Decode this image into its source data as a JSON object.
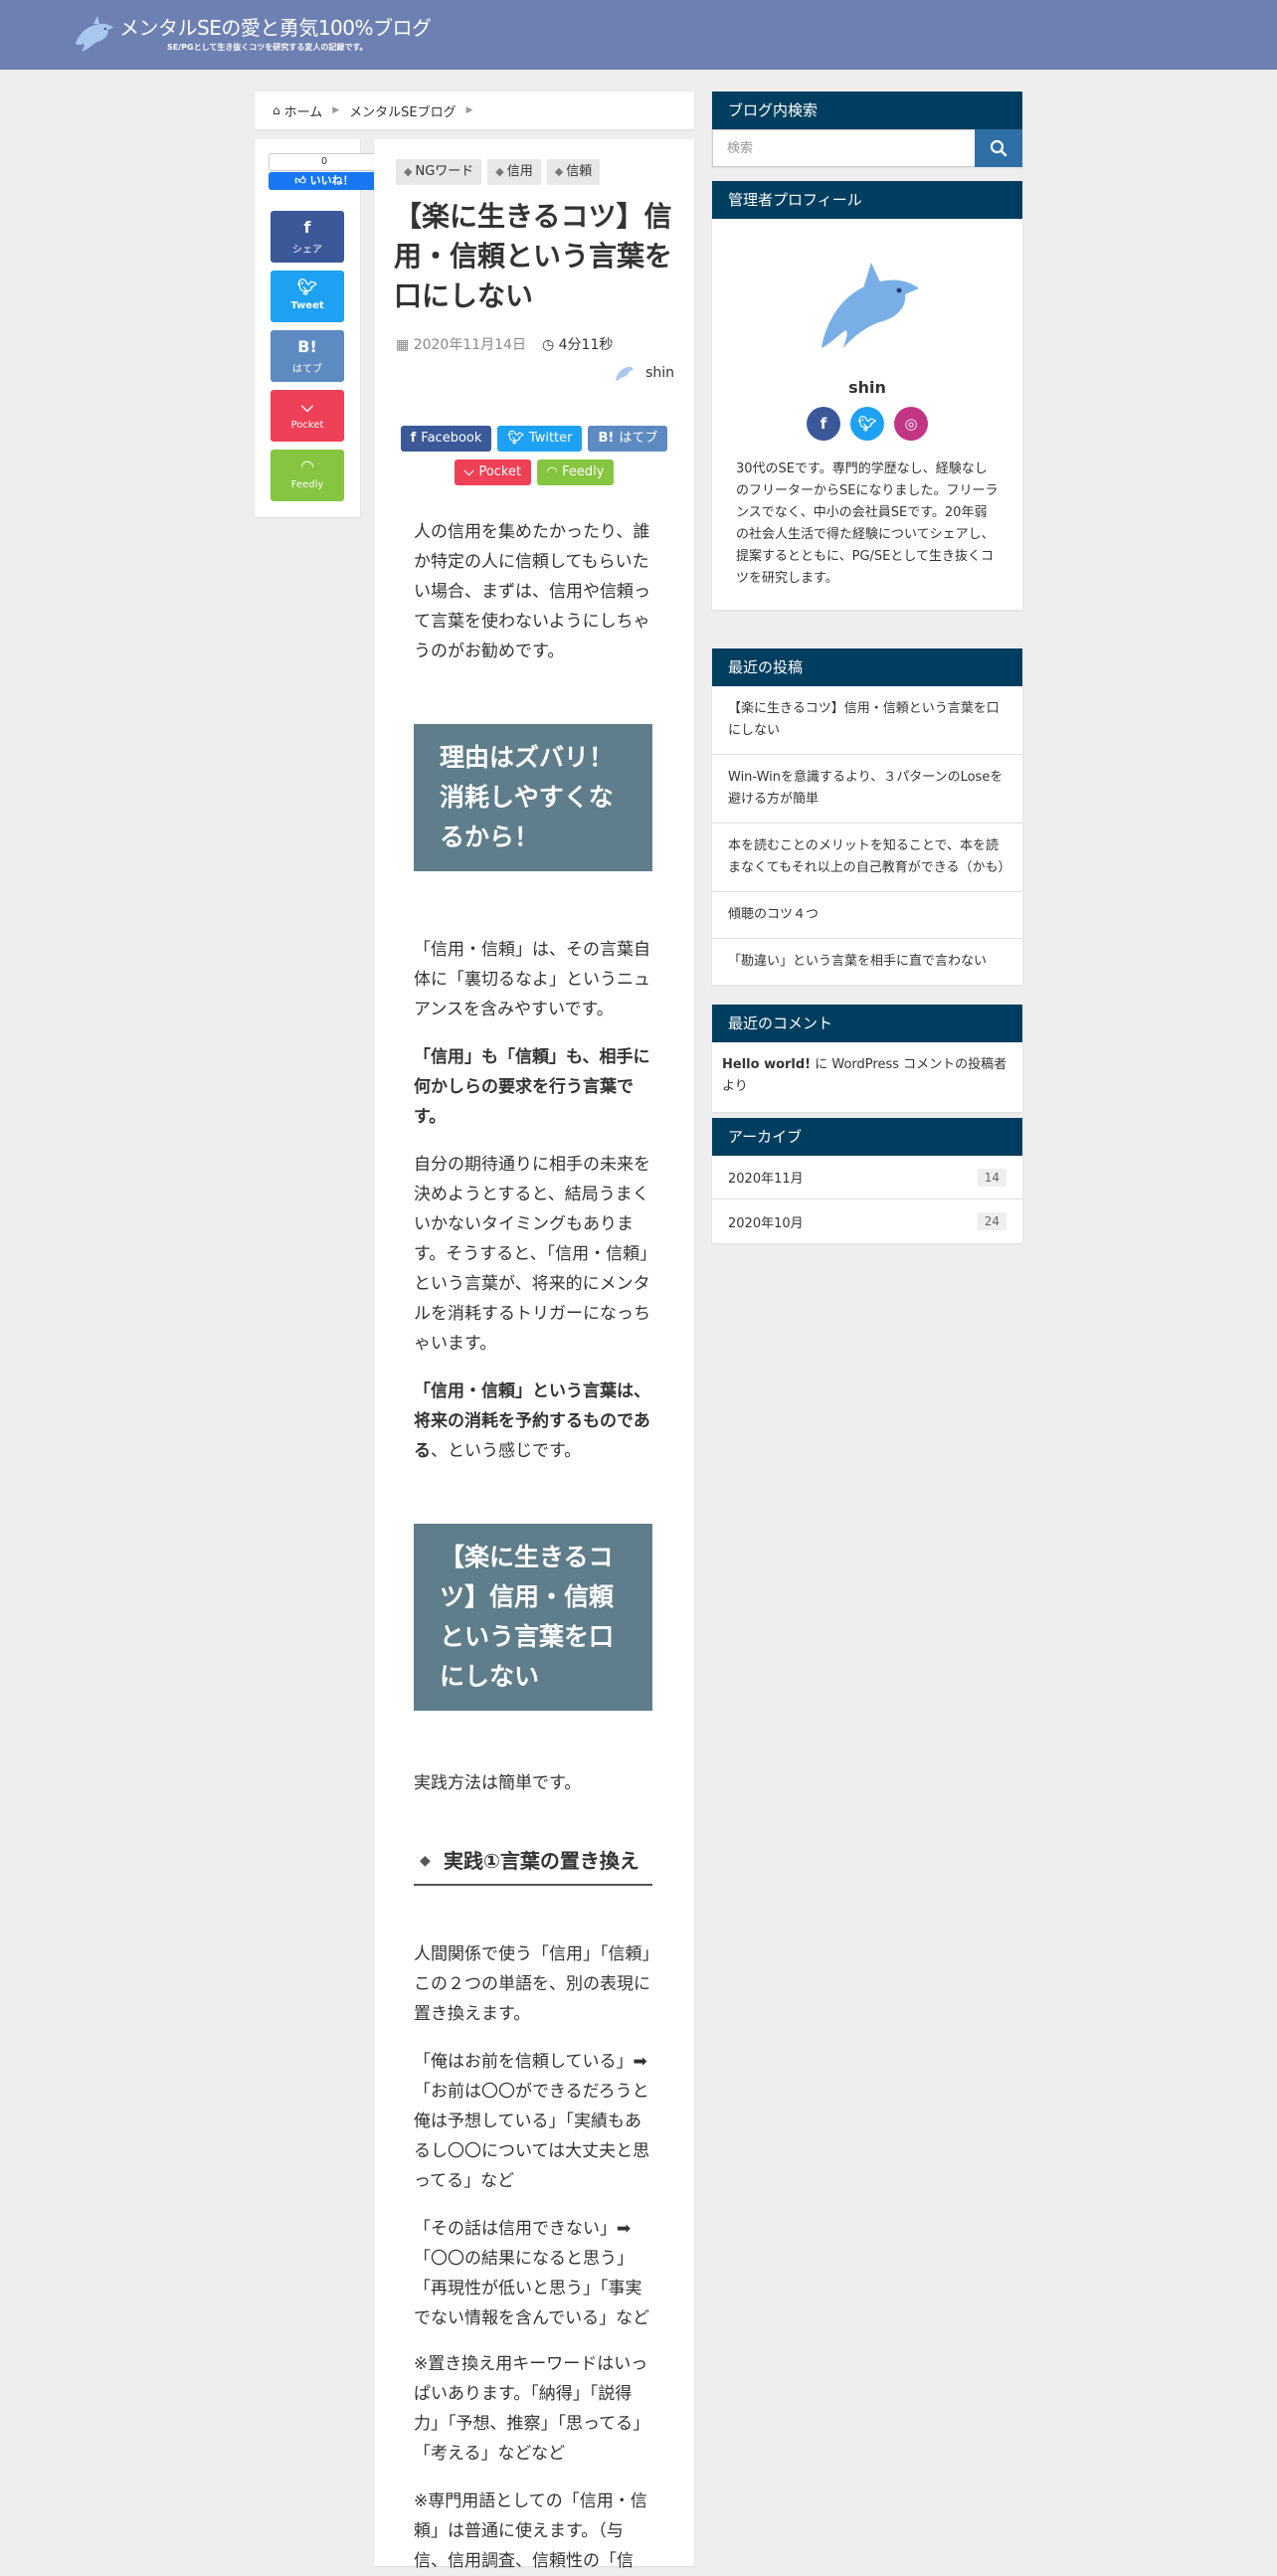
{
  "header": {
    "title": "メンタルSEの愛と勇気100%ブログ",
    "subtitle": "SE/PGとして生き抜くコツを研究する変人の記録です。"
  },
  "breadcrumb": {
    "home": "ホーム",
    "category": "メンタルSEブログ"
  },
  "rail": {
    "like_count": "0",
    "like_label": "いいね！",
    "facebook_icon": "f",
    "facebook_label": "シェア",
    "twitter_label": "Tweet",
    "hatena_icon": "B!",
    "hatena_label": "はてブ",
    "pocket_label": "Pocket",
    "feedly_label": "Feedly"
  },
  "article": {
    "tags": [
      "NGワード",
      "信用",
      "信頼"
    ],
    "title": "【楽に生きるコツ】信用・信頼という言葉を口にしない",
    "date": "2020年11月14日",
    "read_time": "4分11秒",
    "author": "shin",
    "share": {
      "facebook": "Facebook",
      "twitter": "Twitter",
      "hatena": "はてブ",
      "pocket": "Pocket",
      "feedly": "Feedly"
    },
    "intro": "人の信用を集めたかったり、誰か特定の人に信頼してもらいたい場合、まずは、信用や信頼って言葉を使わないようにしちゃうのがお勧めです。",
    "h2_1": "理由はズバリ！消耗しやすくなるから！",
    "p1": "「信用・信頼」は、その言葉自体に「裏切るなよ」というニュアンスを含みやすいです。",
    "p2_bold": "「信用」も「信頼」も、相手に何かしらの要求を行う言葉です。",
    "p3": "自分の期待通りに相手の未来を決めようとすると、結局うまくいかないタイミングもあります。そうすると、「信用・信頼」という言葉が、将来的にメンタルを消耗するトリガーになっちゃいます。",
    "p4_bold": "「信用・信頼」という言葉は、将来の消耗を予約するものである",
    "p4_rest": "、という感じです。",
    "h2_2": "【楽に生きるコツ】信用・信頼という言葉を口にしない",
    "p5": "実践方法は簡単です。",
    "h3_1": "実践①言葉の置き換え",
    "p6": "人間関係で使う「信用」「信頼」この２つの単語を、別の表現に置き換えます。",
    "p7": "「俺はお前を信頼している」➡「お前は〇〇ができるだろうと俺は予想している」「実績もあるし〇〇については大丈夫と思ってる」など",
    "p8": "「その話は信用できない」➡「〇〇の結果になると思う」「再現性が低いと思う」「事実でない情報を含んでいる」など",
    "p9": "※置き換え用キーワードはいっぱいあります。「納得」「説得力」「予想、推察」「思ってる」「考える」などなど",
    "p10": "※専門用語としての「信用・信頼」は普通に使えます。（与信、信用調査、信頼性の「信"
  },
  "sidebar": {
    "search_title": "ブログ内検索",
    "search_placeholder": "検索",
    "profile_title": "管理者プロフィール",
    "profile_name": "shin",
    "profile_desc": "30代のSEです。専門的学歴なし、経験なしのフリーターからSEになりました。フリーランスでなく、中小の会社員SEです。20年弱の社会人生活で得た経験についてシェアし、提案するとともに、PG/SEとして生き抜くコツを研究します。",
    "recent_title": "最近の投稿",
    "recent_posts": [
      "【楽に生きるコツ】信用・信頼という言葉を口にしない",
      "Win-Winを意識するより、３パターンのLoseを避ける方が簡単",
      "本を読むことのメリットを知ることで、本を読まなくてもそれ以上の自己教育ができる（かも）",
      "傾聴のコツ４つ",
      "「勘違い」という言葉を相手に直で言わない"
    ],
    "comments_title": "最近のコメント",
    "comment_post": "Hello world!",
    "comment_mid": " に ",
    "comment_author": "WordPress コメントの投稿者",
    "comment_tail": " より",
    "archive_title": "アーカイブ",
    "archives": [
      {
        "label": "2020年11月",
        "count": "14"
      },
      {
        "label": "2020年10月",
        "count": "24"
      }
    ]
  },
  "colors": {
    "header_bg": "#6e80b2",
    "widget_head": "#003e5f",
    "h2_bg": "#5f7d8a",
    "facebook": "#3b5998",
    "twitter": "#1da1f2",
    "hatena": "#5d8ac1",
    "pocket": "#ee4056",
    "feedly": "#86c540",
    "instagram": "#c13584"
  }
}
